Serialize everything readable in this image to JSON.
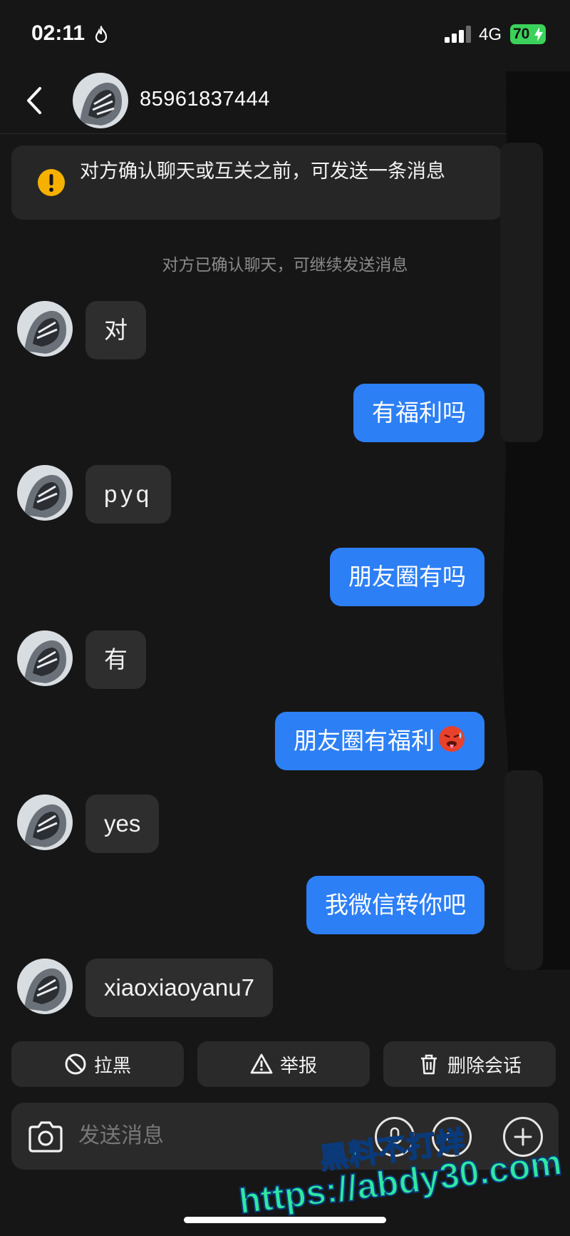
{
  "status_bar": {
    "time": "02:11",
    "network": "4G",
    "battery": "70"
  },
  "header": {
    "title": "85961837444"
  },
  "notice": {
    "text": "对方确认聊天或互关之前，可发送一条消息"
  },
  "system_message": "对方已确认聊天，可继续发送消息",
  "messages": [
    {
      "side": "in",
      "text": "对"
    },
    {
      "side": "out",
      "text": "有福利吗"
    },
    {
      "side": "in",
      "text": "pyq"
    },
    {
      "side": "out",
      "text": "朋友圈有吗"
    },
    {
      "side": "in",
      "text": "有"
    },
    {
      "side": "out",
      "text": "朋友圈有福利",
      "emoji": "hot-face-emoji"
    },
    {
      "side": "in",
      "text": "yes"
    },
    {
      "side": "out",
      "text": "我微信转你吧"
    },
    {
      "side": "in",
      "text": "xiaoxiaoyanu7"
    }
  ],
  "actions": {
    "block": "拉黑",
    "report": "举报",
    "delete": "删除会话"
  },
  "composer": {
    "placeholder": "发送消息"
  },
  "watermark": {
    "line1": "黑料不打烊",
    "line2": "https://abdy30.com"
  },
  "colors": {
    "background": "#161616",
    "outgoing_bubble": "#2d7ff5",
    "incoming_bubble": "#2e2e2e",
    "notice_icon": "#f5b000",
    "battery": "#3bd15a",
    "watermark": "#2fe8a0"
  }
}
